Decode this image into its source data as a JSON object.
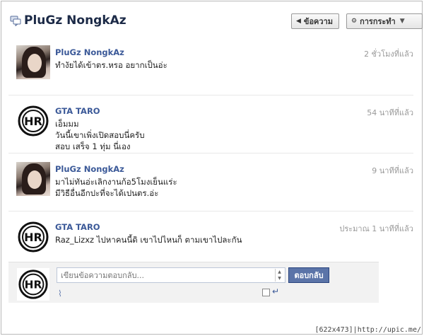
{
  "header": {
    "title": "PluGz NongkAz",
    "back_label": "ข้อความ",
    "actions_label": "การกระทำ"
  },
  "icons": {
    "title": "chat-bubbles-icon",
    "back": "chevron-left-icon",
    "actions": "gear-icon",
    "actions_caret": "caret-down-icon",
    "attach": "paperclip-icon",
    "enter": "enter-arrow-icon"
  },
  "messages": [
    {
      "sender": "PluGz NongkAz",
      "time": "2 ชั่วโมงที่แล้ว",
      "avatar": "photo",
      "lines": [
        "ทำงัยได้เข้าตร.หรอ อยากเป็นอ่ะ"
      ]
    },
    {
      "sender": "GTA TARO",
      "time": "54 นาทีที่แล้ว",
      "avatar": "logo",
      "lines": [
        "เอ็มมม",
        "วันนี้เขาเพิ่งเปิดสอบนี่ครับ",
        "สอบ เสร็จ 1 ทุ่ม นี่เอง"
      ]
    },
    {
      "sender": "PluGz NongkAz",
      "time": "9 นาทีที่แล้ว",
      "avatar": "photo",
      "lines": [
        "มาไม่ทันอ่ะเลิกงานก้อ5โมงเย็นแร่ะ",
        "มีวิธีอื่นอีกปะที่จะได้เปนตร.อ่ะ"
      ]
    },
    {
      "sender": "GTA TARO",
      "time": "ประมาณ 1 นาทีที่แล้ว",
      "avatar": "logo",
      "lines": [
        "Raz_Lizxz ไปหาคนนี้ดิ เขาไปไหนก็ ตามเขาไปละกัน"
      ]
    }
  ],
  "composer": {
    "placeholder": "เขียนข้อความตอบกลับ...",
    "reply_label": "ตอบกลับ"
  },
  "footer": {
    "text": "[622x473]|http://upic.me/"
  },
  "colors": {
    "link": "#3b5998",
    "button": "#5b74a8"
  }
}
